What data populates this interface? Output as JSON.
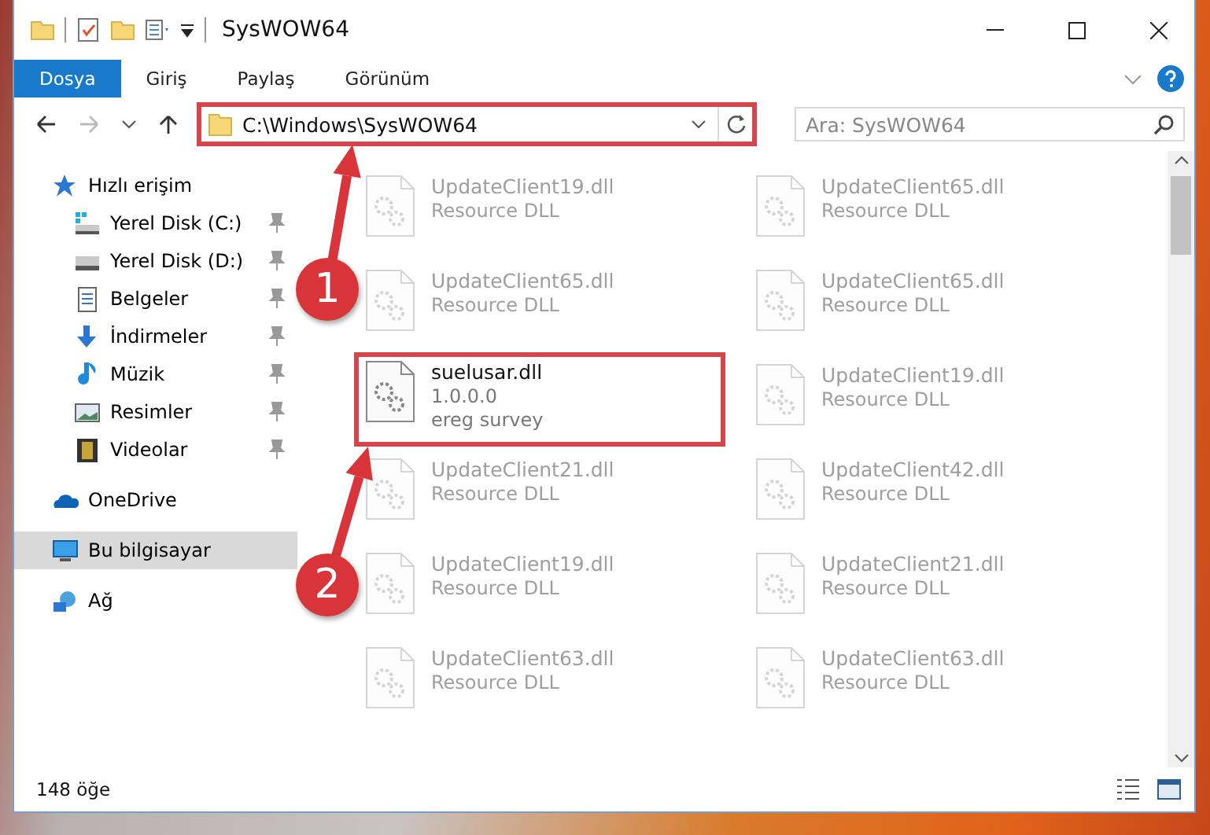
{
  "window": {
    "title": "SysWOW64"
  },
  "ribbon_tabs": [
    {
      "label": "Dosya",
      "selected": true
    },
    {
      "label": "Giriş",
      "selected": false
    },
    {
      "label": "Paylaş",
      "selected": false
    },
    {
      "label": "Görünüm",
      "selected": false
    }
  ],
  "address": {
    "path": "C:\\Windows\\SysWOW64",
    "highlighted": true
  },
  "search": {
    "placeholder": "Ara: SysWOW64"
  },
  "sidebar": {
    "items": [
      {
        "label": "Hızlı erişim",
        "kind": "star",
        "pinned": false,
        "selected": false,
        "children": [
          {
            "label": "Yerel Disk (C:)",
            "kind": "system-drive",
            "pinned": true,
            "selected": false
          },
          {
            "label": "Yerel Disk (D:)",
            "kind": "drive",
            "pinned": true,
            "selected": false
          },
          {
            "label": "Belgeler",
            "kind": "document",
            "pinned": true,
            "selected": false
          },
          {
            "label": "İndirmeler",
            "kind": "download",
            "pinned": true,
            "selected": false
          },
          {
            "label": "Müzik",
            "kind": "music",
            "pinned": true,
            "selected": false
          },
          {
            "label": "Resimler",
            "kind": "picture",
            "pinned": true,
            "selected": false
          },
          {
            "label": "Videolar",
            "kind": "video",
            "pinned": true,
            "selected": false
          }
        ]
      },
      {
        "label": "OneDrive",
        "kind": "cloud",
        "pinned": false,
        "selected": false
      },
      {
        "label": "Bu bilgisayar",
        "kind": "computer",
        "pinned": false,
        "selected": true
      },
      {
        "label": "Ağ",
        "kind": "network",
        "pinned": false,
        "selected": false
      }
    ]
  },
  "files": [
    {
      "name": "UpdateClient19.dll",
      "description": "Resource DLL",
      "faded": true,
      "highlighted": false
    },
    {
      "name": "UpdateClient65.dll",
      "description": "Resource DLL",
      "faded": true,
      "highlighted": false
    },
    {
      "name": "UpdateClient65.dll",
      "description": "Resource DLL",
      "faded": true,
      "highlighted": false
    },
    {
      "name": "UpdateClient65.dll",
      "description": "Resource DLL",
      "faded": true,
      "highlighted": false
    },
    {
      "name": "suelusar.dll",
      "version": "1.0.0.0",
      "description": "ereg survey",
      "faded": false,
      "highlighted": true
    },
    {
      "name": "UpdateClient19.dll",
      "description": "Resource DLL",
      "faded": true,
      "highlighted": false
    },
    {
      "name": "UpdateClient21.dll",
      "description": "Resource DLL",
      "faded": true,
      "highlighted": false
    },
    {
      "name": "UpdateClient42.dll",
      "description": "Resource DLL",
      "faded": true,
      "highlighted": false
    },
    {
      "name": "UpdateClient19.dll",
      "description": "Resource DLL",
      "faded": true,
      "highlighted": false
    },
    {
      "name": "UpdateClient21.dll",
      "description": "Resource DLL",
      "faded": true,
      "highlighted": false
    },
    {
      "name": "UpdateClient63.dll",
      "description": "Resource DLL",
      "faded": true,
      "highlighted": false
    },
    {
      "name": "UpdateClient63.dll",
      "description": "Resource DLL",
      "faded": true,
      "highlighted": false
    }
  ],
  "status_bar": {
    "item_count": "148 öğe"
  },
  "annotations": [
    {
      "number": "1"
    },
    {
      "number": "2"
    }
  ]
}
